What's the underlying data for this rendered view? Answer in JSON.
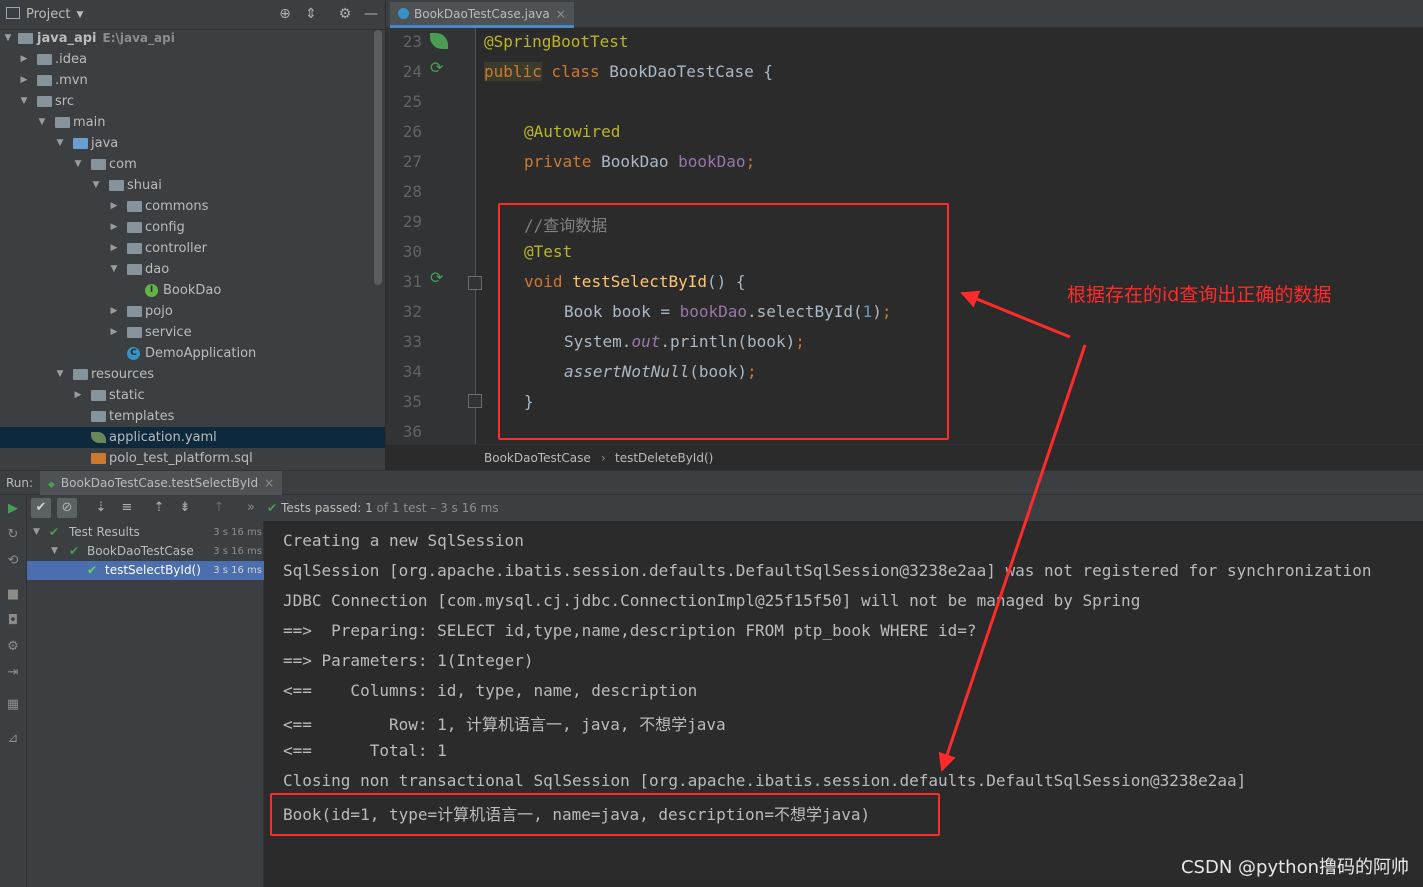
{
  "project_panel": {
    "title": "Project",
    "root_name": "java_api",
    "root_path": "E:\\java_api",
    "tree": [
      {
        "label": "java_api",
        "kind": "root"
      },
      {
        "label": ".idea"
      },
      {
        "label": ".mvn"
      },
      {
        "label": "src"
      },
      {
        "label": "main"
      },
      {
        "label": "java"
      },
      {
        "label": "com"
      },
      {
        "label": "shuai"
      },
      {
        "label": "commons"
      },
      {
        "label": "config"
      },
      {
        "label": "controller"
      },
      {
        "label": "dao"
      },
      {
        "label": "BookDao"
      },
      {
        "label": "pojo"
      },
      {
        "label": "service"
      },
      {
        "label": "DemoApplication"
      },
      {
        "label": "resources"
      },
      {
        "label": "static"
      },
      {
        "label": "templates"
      },
      {
        "label": "application.yaml"
      },
      {
        "label": "polo_test_platform.sql"
      }
    ]
  },
  "editor": {
    "tab_label": "BookDaoTestCase.java",
    "line_numbers": [
      "23",
      "24",
      "25",
      "26",
      "27",
      "28",
      "29",
      "30",
      "31",
      "32",
      "33",
      "34",
      "35",
      "36"
    ],
    "code": {
      "l23": "@SpringBootTest",
      "l24_public": "public",
      "l24_class": " class ",
      "l24_name": "BookDaoTestCase {",
      "l26": "@Autowired",
      "l27_private": "private ",
      "l27_type": "BookDao ",
      "l27_field": "bookDao",
      "l27_end": ";",
      "l29": "//查询数据",
      "l30": "@Test",
      "l31_void": "void ",
      "l31_fn": "testSelectById",
      "l31_end": "() {",
      "l32_a": "Book book = ",
      "l32_field": "bookDao",
      "l32_b": ".selectById(",
      "l32_num": "1",
      "l32_c": ")",
      "l32_semi": ";",
      "l33_a": "System.",
      "l33_out": "out",
      "l33_b": ".println(book)",
      "l33_semi": ";",
      "l34_fn": "assertNotNull",
      "l34_b": "(book)",
      "l34_semi": ";",
      "l35": "}"
    },
    "breadcrumb": {
      "class_name": "BookDaoTestCase",
      "separator": "›",
      "method_name": "testDeleteById()"
    }
  },
  "run_panel": {
    "label": "Run:",
    "tab_label": "BookDaoTestCase.testSelectById",
    "status_prefix": "Tests passed:",
    "status_count": "1",
    "status_suffix": "of 1 test – 3 s 16 ms",
    "results": [
      {
        "label": "Test Results",
        "time": "3 s 16 ms"
      },
      {
        "label": "BookDaoTestCase",
        "time": "3 s 16 ms"
      },
      {
        "label": "testSelectById()",
        "time": "3 s 16 ms"
      }
    ],
    "console_lines": [
      "Creating a new SqlSession",
      "SqlSession [org.apache.ibatis.session.defaults.DefaultSqlSession@3238e2aa] was not registered for synchronization",
      "JDBC Connection [com.mysql.cj.jdbc.ConnectionImpl@25f15f50] will not be managed by Spring",
      "==>  Preparing: SELECT id,type,name,description FROM ptp_book WHERE id=?",
      "==> Parameters: 1(Integer)",
      "<==    Columns: id, type, name, description",
      "<==        Row: 1, 计算机语言一, java, 不想学java",
      "<==      Total: 1",
      "Closing non transactional SqlSession [org.apache.ibatis.session.defaults.DefaultSqlSession@3238e2aa]",
      "Book(id=1, type=计算机语言一, name=java, description=不想学java)"
    ]
  },
  "annotation": {
    "text": "根据存在的id查询出正确的数据",
    "color": "#ff2a2a"
  },
  "watermark": "CSDN @python撸码的阿帅"
}
